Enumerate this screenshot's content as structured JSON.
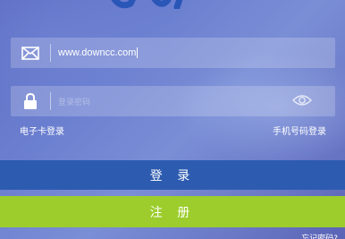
{
  "login": {
    "email_value": "www.downcc.com",
    "password_placeholder": "登录密码",
    "card_login_link": "电子卡登录",
    "phone_login_link": "手机号码登录",
    "login_button": "登 录",
    "register_button": "注 册",
    "forgot_link": "忘记密码?"
  },
  "icons": {
    "email": "envelope-icon",
    "password": "lock-icon",
    "toggle": "eye-icon"
  },
  "colors": {
    "login_button": "#2d5bb0",
    "register_button": "#9ccd2c"
  }
}
